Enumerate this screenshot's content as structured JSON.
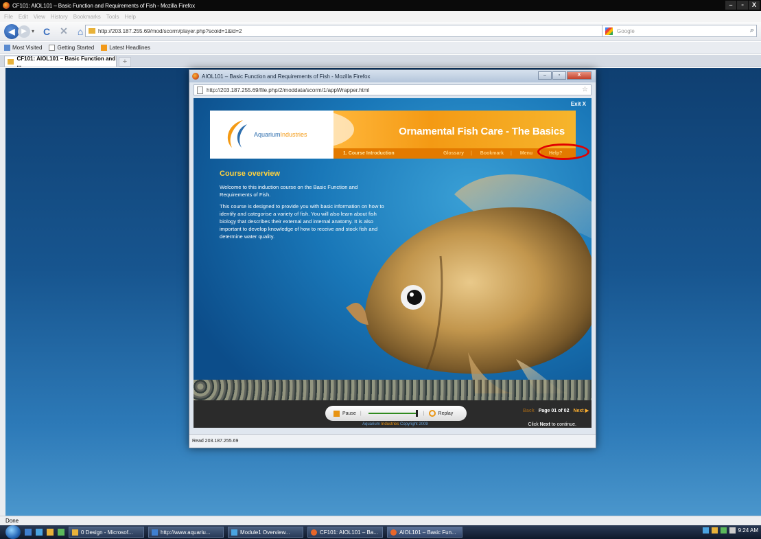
{
  "browser": {
    "title": "CF101: AIOL101 – Basic Function and Requirements of Fish - Mozilla Firefox",
    "menu": [
      "File",
      "Edit",
      "View",
      "History",
      "Bookmarks",
      "Tools",
      "Help"
    ],
    "url": "http://203.187.255.69/mod/scorm/player.php?scoid=1&id=2",
    "search_placeholder": "Google",
    "bookmarks": [
      "Most Visited",
      "Getting Started",
      "Latest Headlines"
    ],
    "tab_label": "CF101: AIOL101 – Basic Function and ...",
    "status": "Done",
    "window_buttons": [
      "–",
      "▫",
      "X"
    ]
  },
  "popup": {
    "title": "AIOL101 – Basic Function and Requirements of Fish - Mozilla Firefox",
    "url": "http://203.187.255.69/file.php/2/moddata/scorm/1/appWrapper.html",
    "status": "Read 203.187.255.69"
  },
  "course": {
    "exit_label": "Exit X",
    "logo_word1": "Aquarium",
    "logo_word2": "Industries",
    "title": "Ornamental Fish Care - The Basics",
    "section_label": "1. Course Introduction",
    "nav": [
      "Glossary",
      "Bookmark",
      "Menu",
      "Help?"
    ],
    "overview_title": "Course overview",
    "overview_p1": "Welcome to this induction course on the Basic Function and Requirements of Fish.",
    "overview_p2": "This course is designed to provide you with basic information on how to identify and categorise a variety of fish. You will also learn about fish biology that describes their external and internal anatomy. It is also important to develop knowledge of how to receive and stock fish and determine water quality.",
    "pause_label": "Pause",
    "replay_label": "Replay",
    "progress": 0.95,
    "copyright_brand1": "Aquarium",
    "copyright_brand2": "Industries",
    "copyright_text": "Copyright 2009",
    "back_label": "Back",
    "page_indicator": "Page 01 of 02",
    "next_label": "Next",
    "hint_prefix": "Click",
    "hint_next": "Next",
    "hint_suffix": "to continue."
  },
  "taskbar": {
    "items": [
      "0 Design - Microsof...",
      "http://www.aquariu...",
      "Module1 Overview...",
      "CF101: AIOL101 – Ba...",
      "AIOL101 – Basic Fun..."
    ],
    "clock": "9:24 AM"
  },
  "colors": {
    "accent_orange": "#f49a14",
    "highlight_red": "#e00000",
    "course_blue": "#0f5693"
  }
}
